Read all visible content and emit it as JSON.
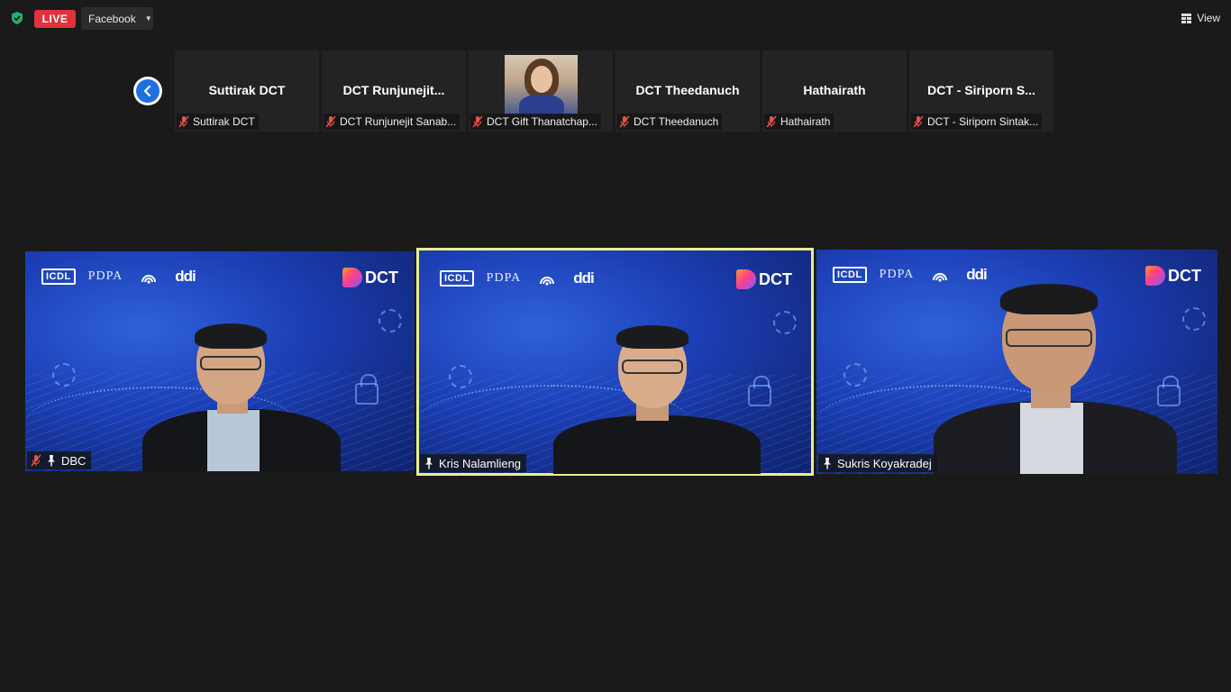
{
  "topbar": {
    "live_label": "LIVE",
    "platform_label": "Facebook",
    "view_label": "View"
  },
  "thumbnails": [
    {
      "big_name": "Suttirak DCT",
      "label": "Suttirak DCT",
      "muted": true,
      "has_video": false
    },
    {
      "big_name": "DCT  Runjunejit...",
      "label": "DCT Runjunejit Sanab...",
      "muted": true,
      "has_video": false
    },
    {
      "big_name": "",
      "label": "DCT Gift Thanatchap...",
      "muted": true,
      "has_video": true
    },
    {
      "big_name": "DCT Theedanuch",
      "label": "DCT Theedanuch",
      "muted": true,
      "has_video": false
    },
    {
      "big_name": "Hathairath",
      "label": "Hathairath",
      "muted": true,
      "has_video": false
    },
    {
      "big_name": "DCT  -  Siriporn  S...",
      "label": "DCT - Siriporn Sintak...",
      "muted": true,
      "has_video": false
    }
  ],
  "speakers": [
    {
      "name": "DBC",
      "muted": true,
      "pinned": true,
      "active": false
    },
    {
      "name": "Kris Nalamlieng",
      "muted": false,
      "pinned": true,
      "active": true
    },
    {
      "name": "Sukris Koyakradej",
      "muted": false,
      "pinned": true,
      "active": false
    }
  ],
  "background_logos": {
    "icdl": "ICDL",
    "pdpa": "PDPA",
    "ddi": "ddi",
    "dct": "DCT"
  },
  "colors": {
    "live_red": "#e0313c",
    "active_speaker_border": "#e8f08a",
    "nav_blue": "#1f6fe0",
    "background": "#1a1a1a"
  }
}
